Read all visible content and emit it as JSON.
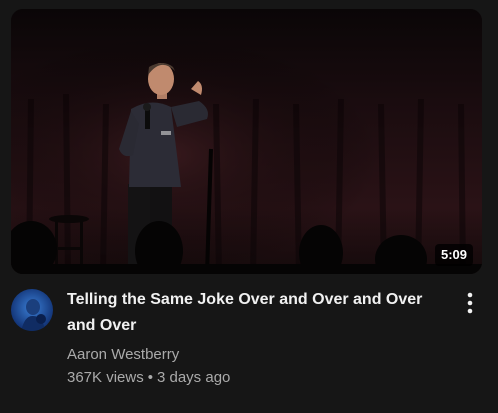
{
  "video": {
    "duration": "5:09",
    "title": "Telling the Same Joke Over and Over and Over and Over",
    "channel": "Aaron Westberry",
    "views": "367K views",
    "separator": "•",
    "age": "3 days ago"
  },
  "icons": {
    "menu": "more-vertical-icon"
  },
  "colors": {
    "background": "#161616",
    "title": "#f1f1f1",
    "secondary_text": "#aaaaaa",
    "duration_badge": "#000000"
  }
}
